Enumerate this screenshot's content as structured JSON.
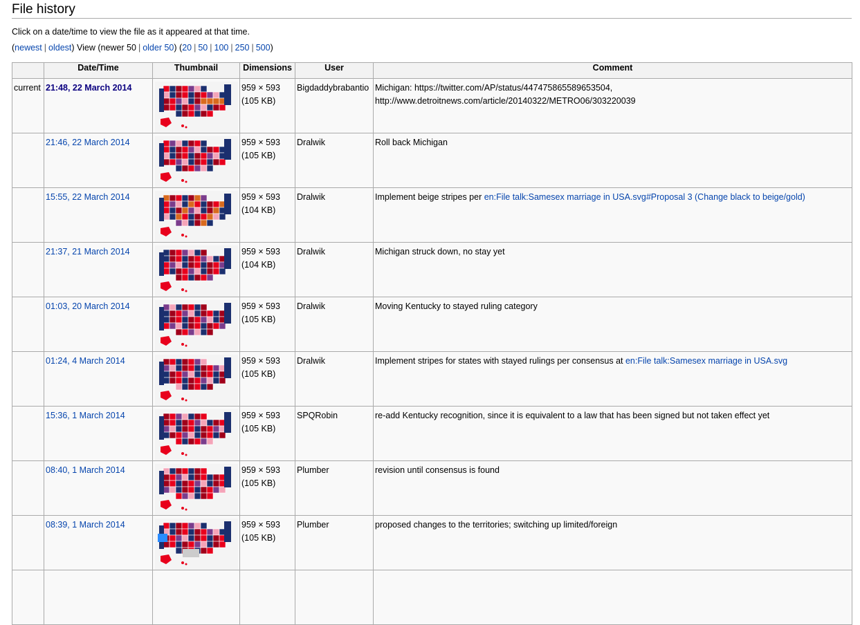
{
  "heading": "File history",
  "intro": "Click on a date/time to view the file as it appeared at that time.",
  "pager": {
    "open": "(",
    "newest": "newest",
    "oldest": "oldest",
    "view_text": ") View (newer 50",
    "older": "older 50",
    "close": ")",
    "n20": "20",
    "n50": "50",
    "n100": "100",
    "n250": "250",
    "n500": "500"
  },
  "columns": [
    "",
    "Date/Time",
    "Thumbnail",
    "Dimensions",
    "User",
    "Comment"
  ],
  "rows": [
    {
      "status": "current",
      "date": "21:48, 22 March 2014",
      "dims": "959 × 593",
      "size": "(105 KB)",
      "user": "Bigdaddybrabantio",
      "comment": "Michigan: https://twitter.com/AP/status/447475865589653504, http://www.detroitnews.com/article/20140322/METRO06/303220039",
      "comment_link": ""
    },
    {
      "status": "",
      "date": "21:46, 22 March 2014",
      "dims": "959 × 593",
      "size": "(105 KB)",
      "user": "Dralwik",
      "comment": "Roll back Michigan",
      "comment_link": ""
    },
    {
      "status": "",
      "date": "15:55, 22 March 2014",
      "dims": "959 × 593",
      "size": "(104 KB)",
      "user": "Dralwik",
      "comment": "Implement beige stripes per ",
      "comment_link": "en:File talk:Samesex marriage in USA.svg#Proposal 3 (Change black to beige/gold)"
    },
    {
      "status": "",
      "date": "21:37, 21 March 2014",
      "dims": "959 × 593",
      "size": "(104 KB)",
      "user": "Dralwik",
      "comment": "Michigan struck down, no stay yet",
      "comment_link": ""
    },
    {
      "status": "",
      "date": "01:03, 20 March 2014",
      "dims": "959 × 593",
      "size": "(105 KB)",
      "user": "Dralwik",
      "comment": "Moving Kentucky to stayed ruling category",
      "comment_link": ""
    },
    {
      "status": "",
      "date": "01:24, 4 March 2014",
      "dims": "959 × 593",
      "size": "(105 KB)",
      "user": "Dralwik",
      "comment": "Implement stripes for states with stayed rulings per consensus at ",
      "comment_link": "en:File talk:Samesex marriage in USA.svg"
    },
    {
      "status": "",
      "date": "15:36, 1 March 2014",
      "dims": "959 × 593",
      "size": "(105 KB)",
      "user": "SPQRobin",
      "comment": "re-add Kentucky recognition, since it is equivalent to a law that has been signed but not taken effect yet",
      "comment_link": ""
    },
    {
      "status": "",
      "date": "08:40, 1 March 2014",
      "dims": "959 × 593",
      "size": "(105 KB)",
      "user": "Plumber",
      "comment": "revision until consensus is found",
      "comment_link": ""
    },
    {
      "status": "",
      "date": "08:39, 1 March 2014",
      "dims": "959 × 593",
      "size": "(105 KB)",
      "user": "Plumber",
      "comment": "proposed changes to the territories; switching up limited/foreign",
      "comment_link": ""
    }
  ],
  "colors": {
    "link": "#0645ad",
    "current_link": "#0b0080",
    "map_red": "#e8001c",
    "map_darkred": "#a0001a",
    "map_navy": "#1b2f6e",
    "map_pink": "#f4a4b8",
    "map_purple": "#7a3c8c",
    "map_orange": "#d96a1e"
  }
}
